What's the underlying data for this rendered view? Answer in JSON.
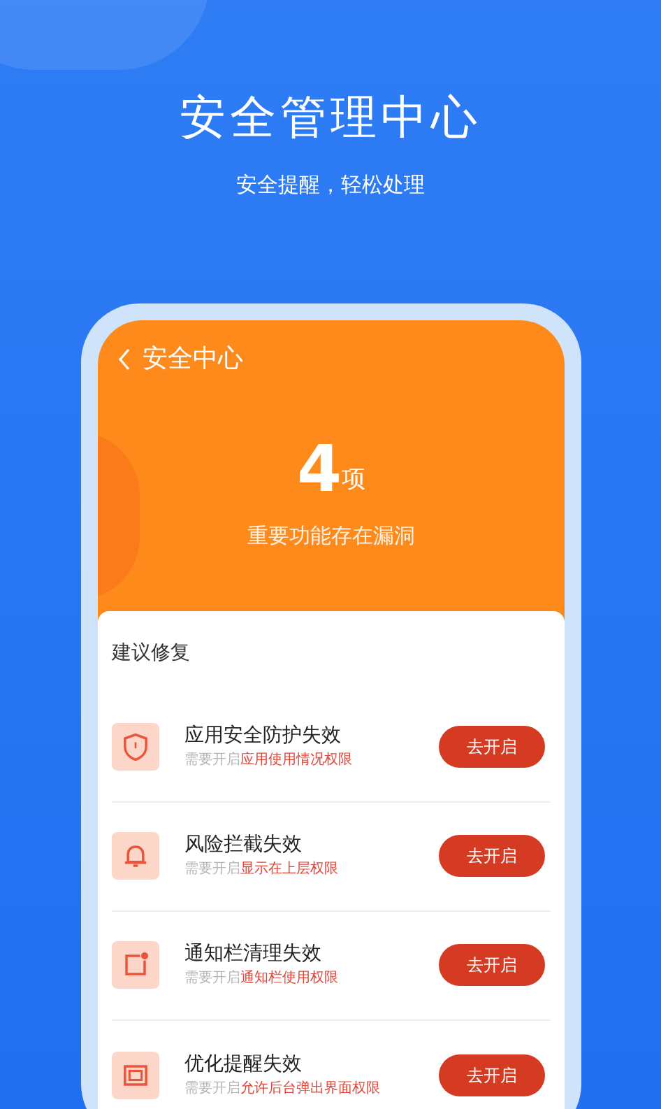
{
  "headline": "安全管理中心",
  "subheadline": "安全提醒，轻松处理",
  "phone": {
    "title": "安全中心",
    "count": "4",
    "count_unit": "项",
    "summary": "重要功能存在漏洞",
    "section_title": "建议修复",
    "items": [
      {
        "kind": "shield",
        "title": "应用安全防护失效",
        "hint": "需要开启",
        "permission": "应用使用情况权限",
        "action": "去开启"
      },
      {
        "kind": "bell",
        "title": "风险拦截失效",
        "hint": "需要开启",
        "permission": "显示在上层权限",
        "action": "去开启"
      },
      {
        "kind": "notification",
        "title": "通知栏清理失效",
        "hint": "需要开启",
        "permission": "通知栏使用权限",
        "action": "去开启"
      },
      {
        "kind": "window",
        "title": "优化提醒失效",
        "hint": "需要开启",
        "permission": "允许后台弹出界面权限",
        "action": "去开启"
      }
    ]
  }
}
